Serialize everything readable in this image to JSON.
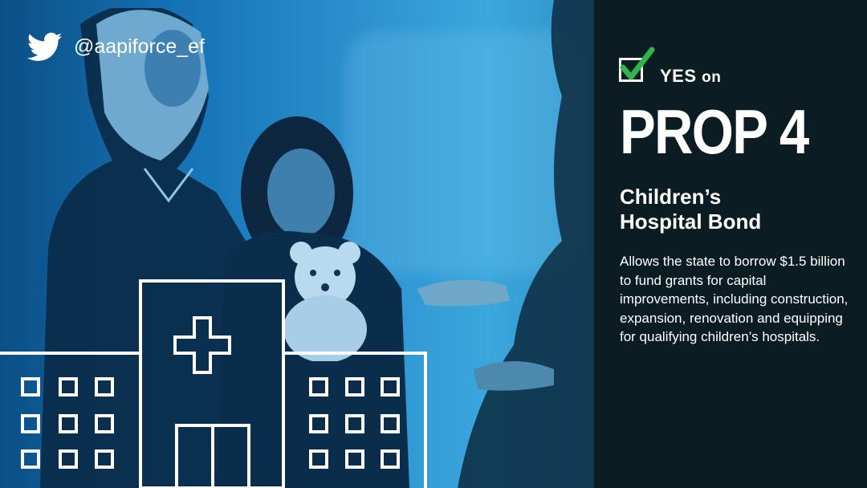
{
  "social": {
    "icon": "twitter-bird-icon",
    "handle": "@aapiforce_ef"
  },
  "badge": {
    "icon": "checkbox-check-icon",
    "check_color": "#2fb54a",
    "yes": "YES",
    "on": "on"
  },
  "title": "PROP 4",
  "subtitle_line1": "Children’s",
  "subtitle_line2": "Hospital Bond",
  "description": "Allows the state to borrow $1.5 billion to fund grants for capital improvements, including construction, expansion, renovation and equipping for qualifying children’s hospitals.",
  "illustration": {
    "icon": "hospital-building-outline-icon"
  },
  "colors": {
    "panel_bg": "#0b1c22",
    "photo_tint": "#1a7fc0",
    "text": "#ffffff"
  }
}
